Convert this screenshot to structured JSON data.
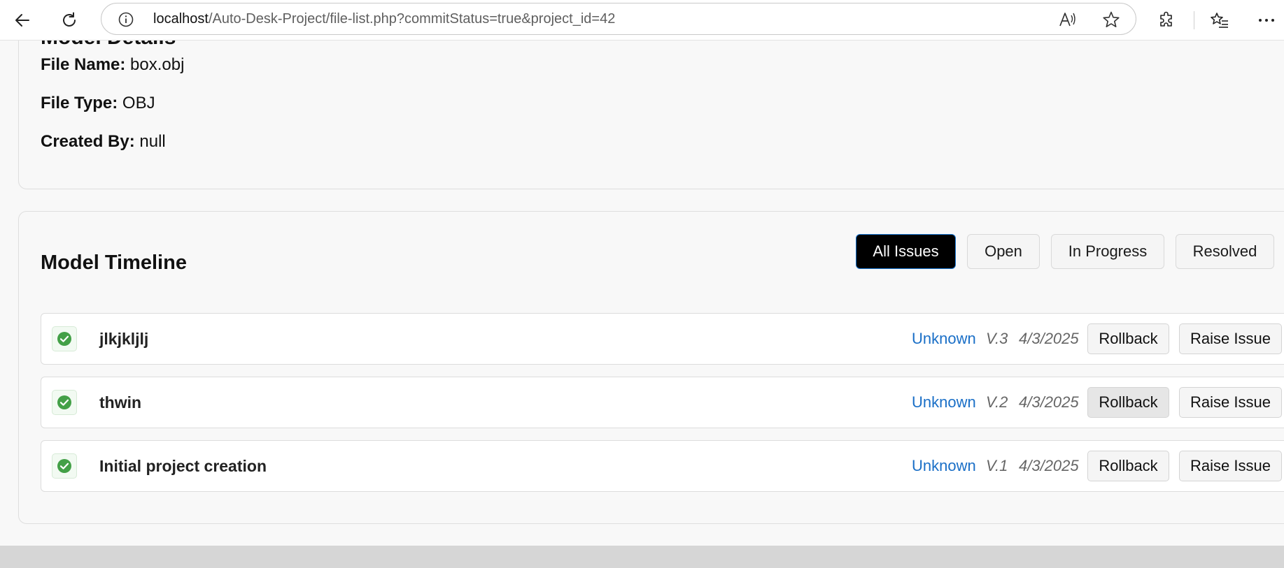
{
  "browser": {
    "url_host": "localhost",
    "url_path": "/Auto-Desk-Project/file-list.php?commitStatus=true&project_id=42"
  },
  "details": {
    "heading": "Model Details",
    "file_name_label": "File Name:",
    "file_name": "box.obj",
    "file_type_label": "File Type:",
    "file_type": "OBJ",
    "created_by_label": "Created By:",
    "created_by": "null"
  },
  "timeline": {
    "heading": "Model Timeline",
    "filters": [
      "All Issues",
      "Open",
      "In Progress",
      "Resolved"
    ],
    "active_filter": "All Issues",
    "rollback_label": "Rollback",
    "raise_issue_label": "Raise Issue",
    "commits": [
      {
        "message": "jlkjkljlj",
        "author": "Unknown",
        "version": "V.3",
        "date": "4/3/2025",
        "status": "success"
      },
      {
        "message": "thwin",
        "author": "Unknown",
        "version": "V.2",
        "date": "4/3/2025",
        "status": "success"
      },
      {
        "message": "Initial project creation",
        "author": "Unknown",
        "version": "V.1",
        "date": "4/3/2025",
        "status": "success"
      }
    ]
  },
  "colors": {
    "active_filter_bg": "#000000",
    "author_link": "#1a6fc7",
    "check_green": "#43a047"
  },
  "icons": [
    "back-arrow-icon",
    "refresh-icon",
    "info-icon",
    "read-aloud-icon",
    "favorite-star-icon",
    "extensions-icon",
    "favorites-list-icon",
    "more-menu-icon",
    "check-circle-icon"
  ]
}
